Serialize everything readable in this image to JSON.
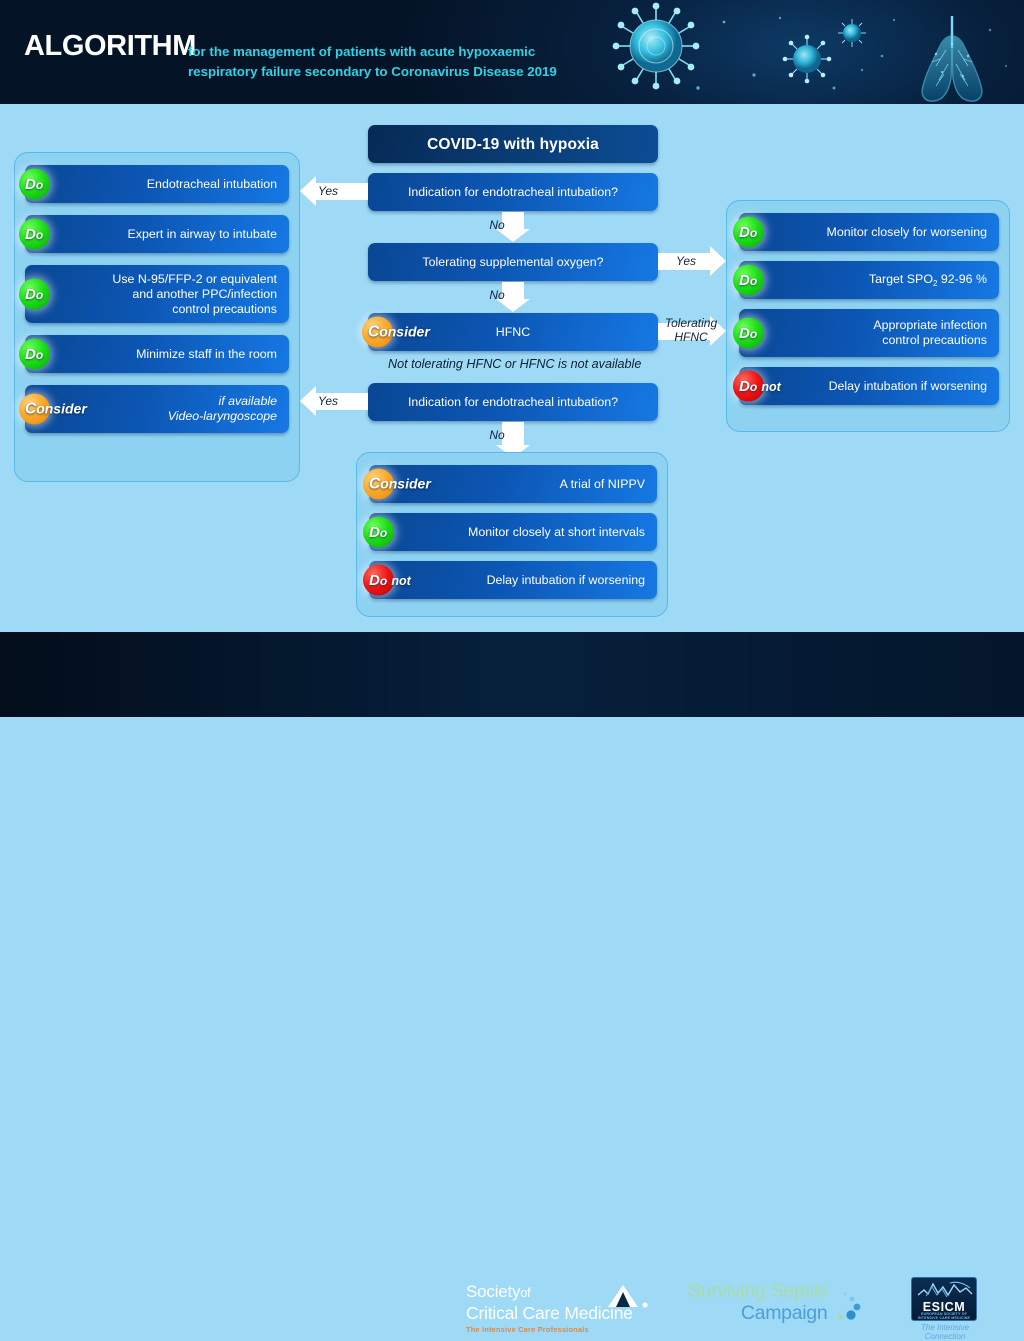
{
  "header": {
    "title": "ALGORITHM",
    "subtitle_line1": "for the management of patients with acute hypoxaemic",
    "subtitle_line2": "respiratory failure secondary to Coronavirus Disease 2019",
    "accent_color": "#2fd3e8",
    "background_color": "#04142a",
    "artwork": "coronavirus-and-lungs-illustration"
  },
  "canvas": {
    "background_color": "#9ed9f6",
    "panel_border_color": "#57b9e8"
  },
  "flow": {
    "start": {
      "label": "COVID-19 with hypoxia"
    },
    "decision1": {
      "label": "Indication for endotracheal intubation?"
    },
    "decision2": {
      "label": "Tolerating supplemental oxygen?"
    },
    "hfnc": {
      "badge": "Consider",
      "label": "HFNC"
    },
    "decision3": {
      "label": "Indication for endotracheal intubation?"
    },
    "note_hfnc": "Not tolerating HFNC or HFNC is not available",
    "edges": {
      "d1_yes": "Yes",
      "d1_no": "No",
      "d2_yes": "Yes",
      "d2_no": "No",
      "hfnc_tolerating": "Tolerating\nHFNC",
      "tolerating_line1": "Tolerating",
      "tolerating_line2": "HFNC",
      "d3_yes": "Yes",
      "d3_no": "No"
    }
  },
  "panel_left": {
    "name": "intubation-actions",
    "items": [
      {
        "badge": "Do",
        "badge_type": "do",
        "badge_color": "#1ddc18",
        "text": "Endotracheal intubation"
      },
      {
        "badge": "Do",
        "badge_type": "do",
        "badge_color": "#1ddc18",
        "text": "Expert in airway to intubate"
      },
      {
        "badge": "Do",
        "badge_type": "do",
        "badge_color": "#1ddc18",
        "text": "Use N-95/FFP-2 or equivalent\nand another PPC/infection\ncontrol precautions"
      },
      {
        "badge": "Do",
        "badge_type": "do",
        "badge_color": "#1ddc18",
        "text": "Minimize staff in the room"
      },
      {
        "badge": "Consider",
        "badge_type": "consider",
        "badge_color": "#f9a82a",
        "text": "if available\nVideo-laryngoscope",
        "italic_first_line": true
      }
    ]
  },
  "panel_right": {
    "name": "oxygen-tolerating-actions",
    "items": [
      {
        "badge": "Do",
        "badge_type": "do",
        "badge_color": "#1ddc18",
        "text": "Monitor closely for worsening"
      },
      {
        "badge": "Do",
        "badge_type": "do",
        "badge_color": "#1ddc18",
        "text": "Target SPO2 92-96 %",
        "has_subscript": true,
        "text_pre": "Target SPO",
        "text_sub": "2",
        "text_post": " 92-96 %"
      },
      {
        "badge": "Do",
        "badge_type": "do",
        "badge_color": "#1ddc18",
        "text": "Appropriate infection\ncontrol precautions"
      },
      {
        "badge": "Do not",
        "badge_type": "not",
        "badge_color": "#ef1414",
        "text": "Delay intubation if worsening"
      }
    ]
  },
  "panel_nippv": {
    "name": "nippv-actions",
    "items": [
      {
        "badge": "Consider",
        "badge_type": "consider",
        "badge_color": "#f9a82a",
        "text": "A trial of NIPPV"
      },
      {
        "badge": "Do",
        "badge_type": "do",
        "badge_color": "#1ddc18",
        "text": "Monitor closely at short intervals"
      },
      {
        "badge": "Do not",
        "badge_type": "not",
        "badge_color": "#ef1414",
        "text": "Delay intubation if worsening"
      }
    ]
  },
  "footer": {
    "sccm": {
      "line1_main": "Society",
      "line1_small": "of",
      "line2": "Critical Care Medicine",
      "tagline": "The Intensive Care Professionals"
    },
    "ssc": {
      "line1": "Surviving Sepsis",
      "line2": "Campaign"
    },
    "esicm": {
      "name": "ESICM",
      "sub_line1": "EUROPEAN SOCIETY OF",
      "sub_line2": "INTENSIVE CARE MEDICINE",
      "tagline": "The Intensive Connection"
    }
  }
}
